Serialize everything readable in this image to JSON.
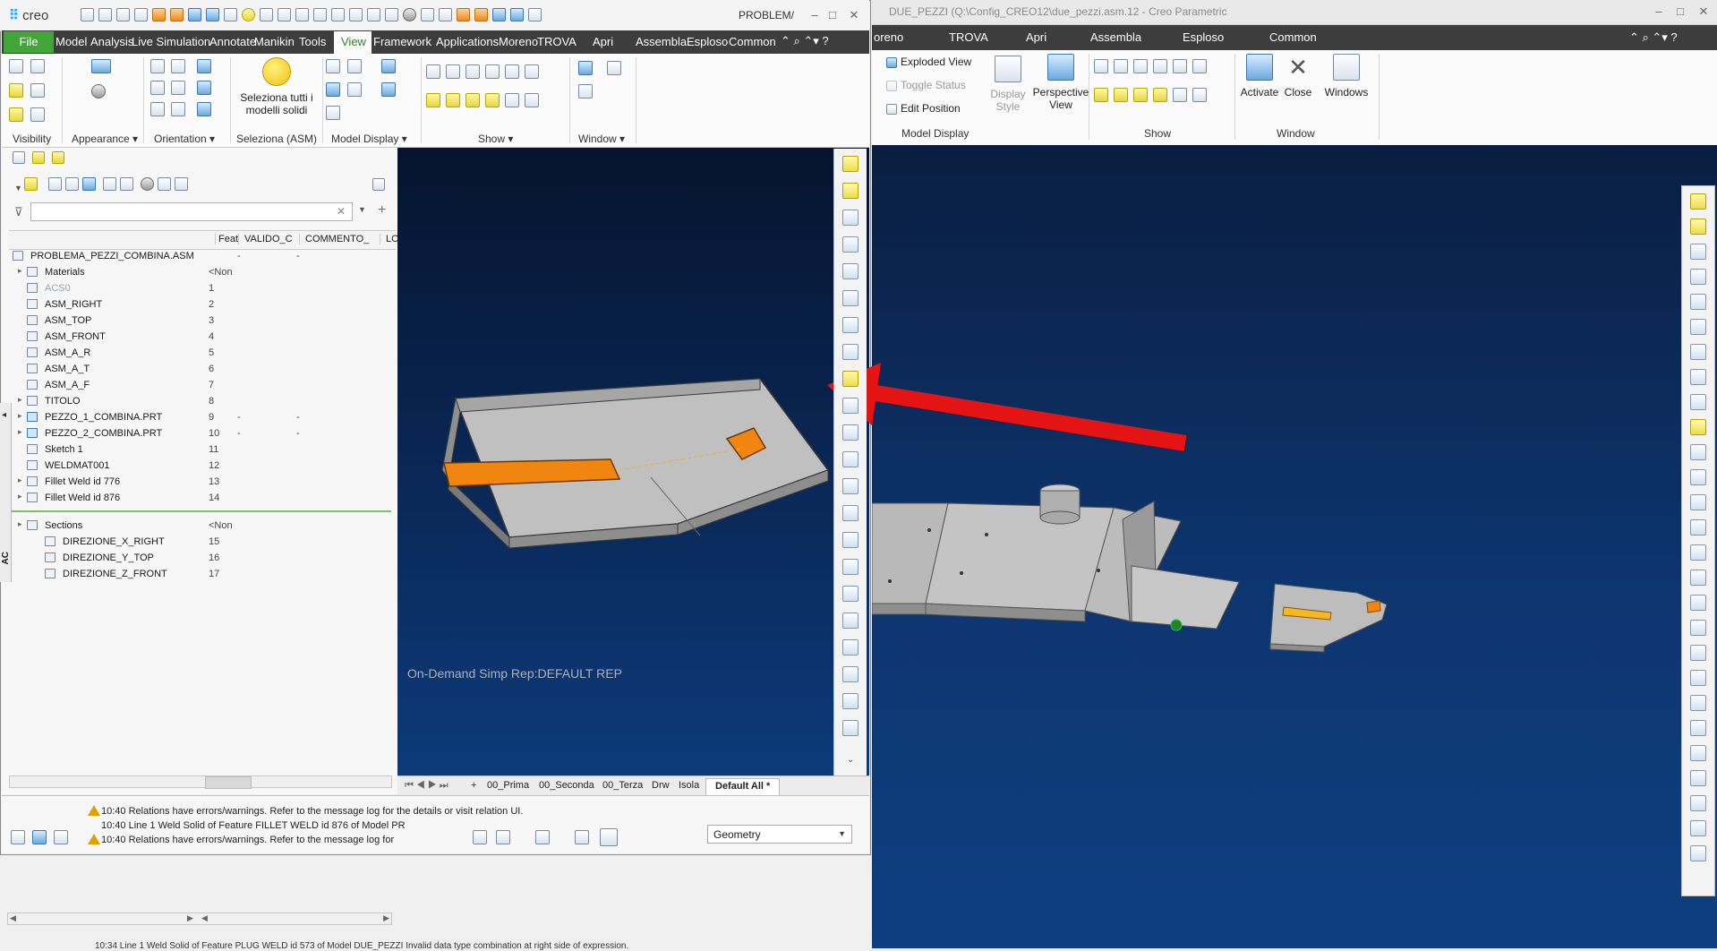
{
  "background_window": {
    "title": "DUE_PEZZI (Q:\\Config_CREO12\\due_pezzi.asm.12 - Creo Parametric",
    "tabs": [
      "oreno",
      "TROVA",
      "Apri",
      "Assembla",
      "Esploso",
      "Common"
    ],
    "model_display": {
      "items": [
        "Exploded View",
        "Toggle Status",
        "Edit Position"
      ],
      "display_style": "Display Style",
      "perspective": "Perspective View",
      "label": "Model Display"
    },
    "show_label": "Show",
    "window_group": {
      "activate": "Activate",
      "close": "Close",
      "windows": "Windows",
      "label": "Window"
    },
    "status_text": "10:34 Line 1 Weld Solid of Feature PLUG WELD id 573 of Model DUE_PEZZI Invalid data type combination at right side of expression."
  },
  "app": {
    "logo": "creo",
    "window_title": "PROBLEM/",
    "window_controls": [
      "–",
      "□",
      "✕"
    ]
  },
  "tabs": [
    "File",
    "Model",
    "Analysis",
    "Live Simulation",
    "Annotate",
    "Manikin",
    "Tools",
    "View",
    "Framework",
    "Applications",
    "Moreno",
    "TROVA",
    "Apri",
    "Assembla",
    "Esploso",
    "Common"
  ],
  "active_tab": "View",
  "ribbon_groups": {
    "visibility": "Visibility",
    "appearance": "Appearance",
    "orientation": "Orientation",
    "seleziona": "Seleziona (ASM)",
    "seleziona_button": "Seleziona tutti i modelli solidi",
    "model_display": "Model Display",
    "show": "Show",
    "window": "Window"
  },
  "tree": {
    "columns": [
      "Feat",
      "VALIDO_C",
      "COMMENTO_",
      "LO"
    ],
    "rows": [
      {
        "name": "PROBLEMA_PEZZI_COMBINA.ASM",
        "feat": "",
        "valido": "-",
        "comm": "-"
      },
      {
        "name": "Materials",
        "feat": "<Non",
        "valido": "",
        "comm": ""
      },
      {
        "name": "ACS0",
        "feat": "1",
        "valido": "",
        "comm": ""
      },
      {
        "name": "ASM_RIGHT",
        "feat": "2",
        "valido": "",
        "comm": ""
      },
      {
        "name": "ASM_TOP",
        "feat": "3",
        "valido": "",
        "comm": ""
      },
      {
        "name": "ASM_FRONT",
        "feat": "4",
        "valido": "",
        "comm": ""
      },
      {
        "name": "ASM_A_R",
        "feat": "5",
        "valido": "",
        "comm": ""
      },
      {
        "name": "ASM_A_T",
        "feat": "6",
        "valido": "",
        "comm": ""
      },
      {
        "name": "ASM_A_F",
        "feat": "7",
        "valido": "",
        "comm": ""
      },
      {
        "name": "TITOLO",
        "feat": "8",
        "valido": "",
        "comm": ""
      },
      {
        "name": "PEZZO_1_COMBINA.PRT",
        "feat": "9",
        "valido": "-",
        "comm": "-"
      },
      {
        "name": "PEZZO_2_COMBINA.PRT",
        "feat": "10",
        "valido": "-",
        "comm": "-"
      },
      {
        "name": "Sketch 1",
        "feat": "11",
        "valido": "",
        "comm": ""
      },
      {
        "name": "WELDMAT001",
        "feat": "12",
        "valido": "",
        "comm": ""
      },
      {
        "name": "Fillet Weld id 776",
        "feat": "13",
        "valido": "",
        "comm": ""
      },
      {
        "name": "Fillet Weld id 876",
        "feat": "14",
        "valido": "",
        "comm": ""
      },
      {
        "name": "Sections",
        "feat": "<Non",
        "valido": "",
        "comm": ""
      },
      {
        "name": "DIREZIONE_X_RIGHT",
        "feat": "15",
        "valido": "",
        "comm": ""
      },
      {
        "name": "DIREZIONE_Y_TOP",
        "feat": "16",
        "valido": "",
        "comm": ""
      },
      {
        "name": "DIREZIONE_Z_FRONT",
        "feat": "17",
        "valido": "",
        "comm": ""
      }
    ]
  },
  "graphics": {
    "simp_rep": "On-Demand Simp Rep:DEFAULT REP"
  },
  "layer_tabs": [
    "00_Prima",
    "00_Seconda",
    "00_Terza",
    "Drw",
    "Isola",
    "Default All *"
  ],
  "messages": [
    "10:40 Relations have errors/warnings. Refer to the message log for the details or visit relation UI.",
    "10:40 Line 1 Weld Solid of Feature FILLET WELD id 876 of Model PR",
    "10:40 Relations have errors/warnings. Refer to the message log for"
  ],
  "filter": {
    "value": "Geometry"
  },
  "side_label": "AC",
  "colors": {
    "file_tab": "#43a43a",
    "weld": "#f0860f",
    "arrow": "#e41414",
    "viewport": "#0a2a5c"
  }
}
